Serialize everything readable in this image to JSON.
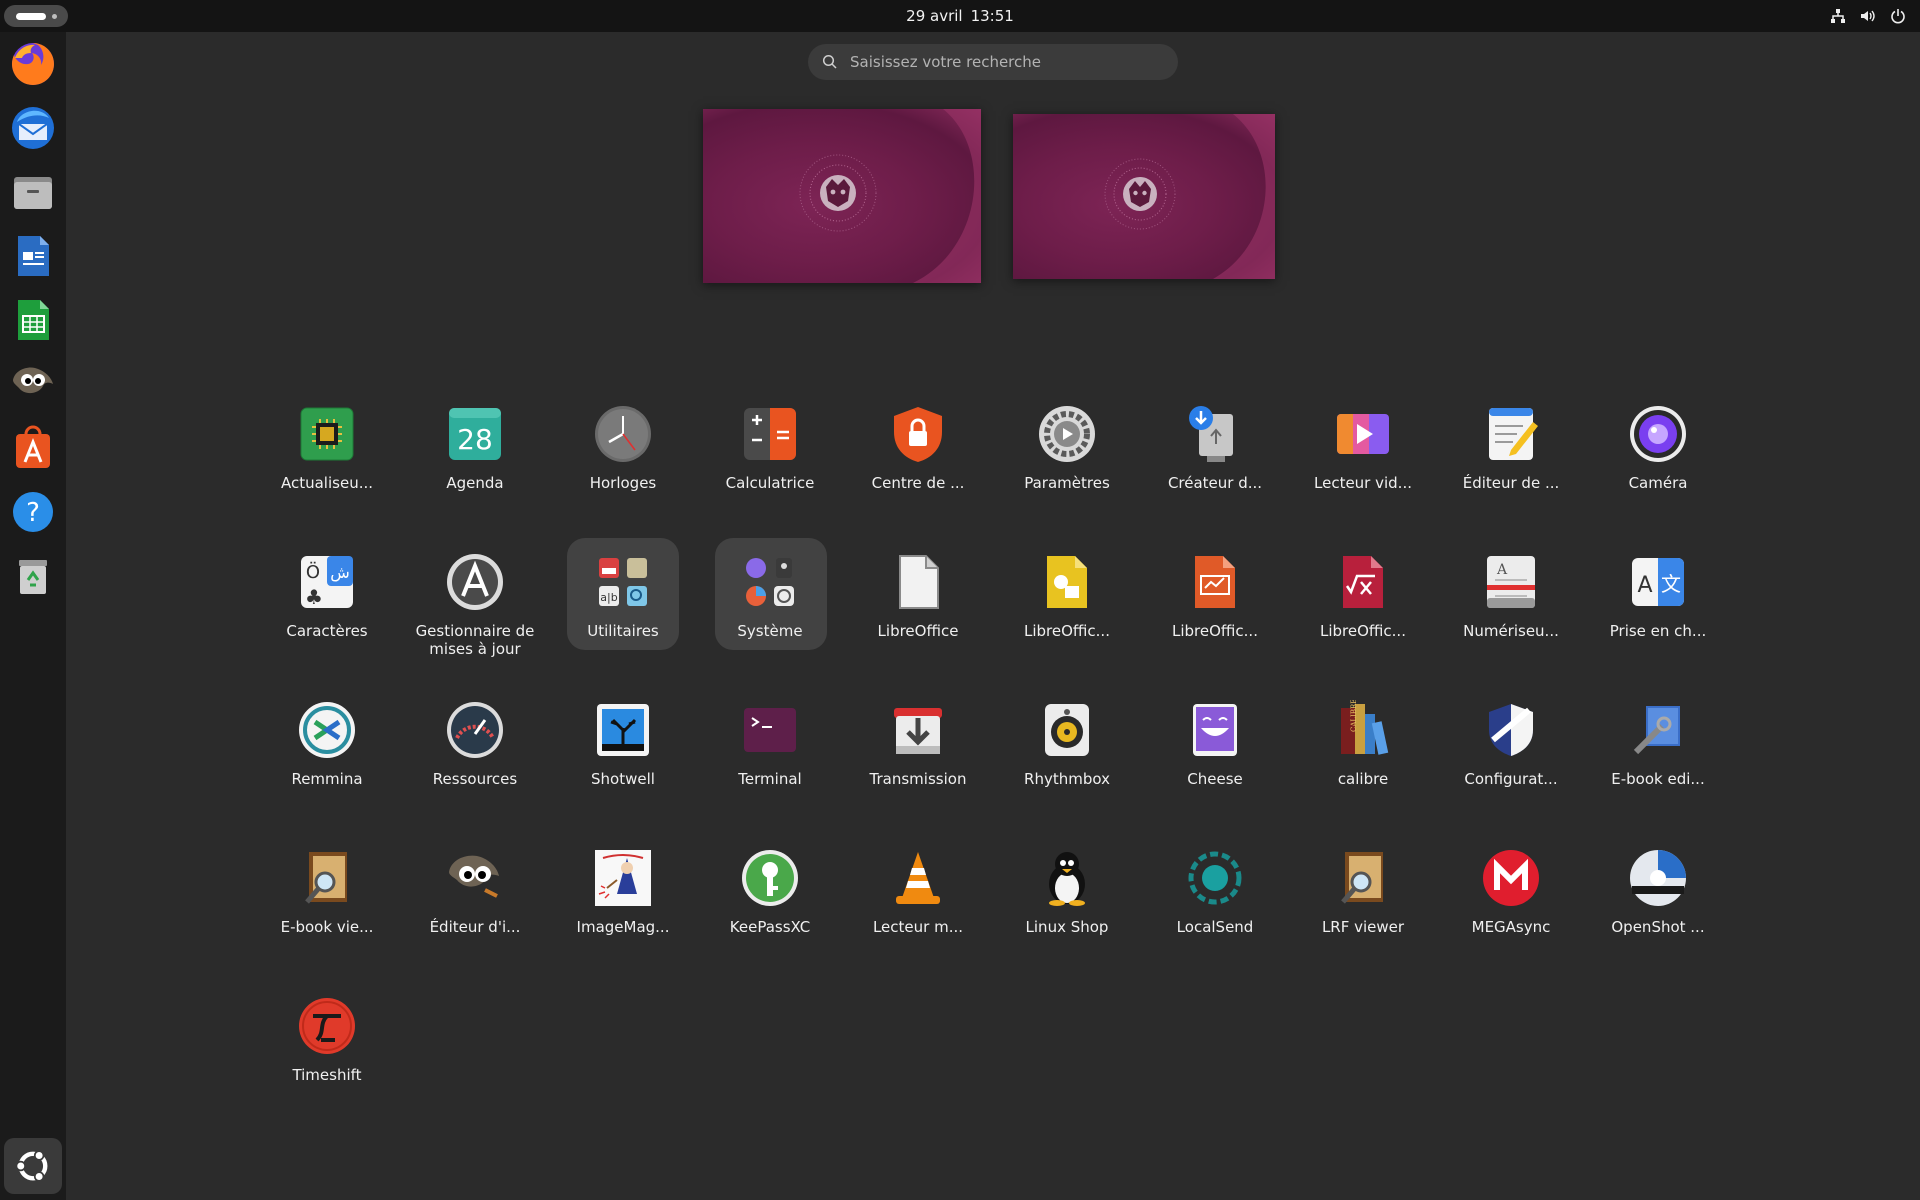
{
  "topbar": {
    "date": "29 avril",
    "time": "13:51",
    "tray_icons": [
      "network-icon",
      "volume-icon",
      "power-icon"
    ]
  },
  "search": {
    "placeholder": "Saisissez votre recherche",
    "value": ""
  },
  "dock": {
    "items": [
      "Firefox",
      "Thunderbird",
      "Fichiers",
      "LibreOffice Writer",
      "LibreOffice Calc",
      "GIMP",
      "App Center",
      "Aide",
      "Corbeille"
    ],
    "show_apps_label": "Afficher les applications"
  },
  "apps": [
    {
      "label": "Actualiseu...",
      "icon": "firmware-icon"
    },
    {
      "label": "Agenda",
      "icon": "calendar-icon",
      "badge": "28"
    },
    {
      "label": "Horloges",
      "icon": "clock-icon"
    },
    {
      "label": "Calculatrice",
      "icon": "calculator-icon"
    },
    {
      "label": "Centre de ...",
      "icon": "security-center-icon"
    },
    {
      "label": "Paramètres",
      "icon": "settings-icon"
    },
    {
      "label": "Créateur d...",
      "icon": "usb-creator-icon"
    },
    {
      "label": "Lecteur vid...",
      "icon": "video-player-icon"
    },
    {
      "label": "Éditeur de ...",
      "icon": "text-editor-icon"
    },
    {
      "label": "Caméra",
      "icon": "camera-icon"
    },
    {
      "label": "Caractères",
      "icon": "characters-icon"
    },
    {
      "label": "Gestionnaire de mises à jour",
      "icon": "update-manager-icon"
    },
    {
      "label": "Utilitaires",
      "icon": "utilities-folder-icon"
    },
    {
      "label": "Système",
      "icon": "system-folder-icon"
    },
    {
      "label": "LibreOffice",
      "icon": "libreoffice-icon"
    },
    {
      "label": "LibreOffic...",
      "icon": "libreoffice-draw-icon"
    },
    {
      "label": "LibreOffic...",
      "icon": "libreoffice-impress-icon"
    },
    {
      "label": "LibreOffic...",
      "icon": "libreoffice-math-icon"
    },
    {
      "label": "Numériseu...",
      "icon": "scanner-icon"
    },
    {
      "label": "Prise en ch...",
      "icon": "language-support-icon"
    },
    {
      "label": "Remmina",
      "icon": "remmina-icon"
    },
    {
      "label": "Ressources",
      "icon": "resources-icon"
    },
    {
      "label": "Shotwell",
      "icon": "shotwell-icon"
    },
    {
      "label": "Terminal",
      "icon": "terminal-icon"
    },
    {
      "label": "Transmission",
      "icon": "transmission-icon"
    },
    {
      "label": "Rhythmbox",
      "icon": "rhythmbox-icon"
    },
    {
      "label": "Cheese",
      "icon": "cheese-icon"
    },
    {
      "label": "calibre",
      "icon": "calibre-icon"
    },
    {
      "label": "Configurat...",
      "icon": "firewall-config-icon"
    },
    {
      "label": "E-book edi...",
      "icon": "ebook-editor-icon"
    },
    {
      "label": "E-book vie...",
      "icon": "ebook-viewer-icon"
    },
    {
      "label": "Éditeur d'i...",
      "icon": "gimp-icon"
    },
    {
      "label": "ImageMag...",
      "icon": "imagemagick-icon"
    },
    {
      "label": "KeePassXC",
      "icon": "keepassxc-icon"
    },
    {
      "label": "Lecteur m...",
      "icon": "vlc-icon"
    },
    {
      "label": "Linux Shop",
      "icon": "linux-shop-icon"
    },
    {
      "label": "LocalSend",
      "icon": "localsend-icon"
    },
    {
      "label": "LRF viewer",
      "icon": "lrf-viewer-icon"
    },
    {
      "label": "MEGAsync",
      "icon": "megasync-icon"
    },
    {
      "label": "OpenShot ...",
      "icon": "openshot-icon"
    },
    {
      "label": "Timeshift",
      "icon": "timeshift-icon"
    }
  ]
}
